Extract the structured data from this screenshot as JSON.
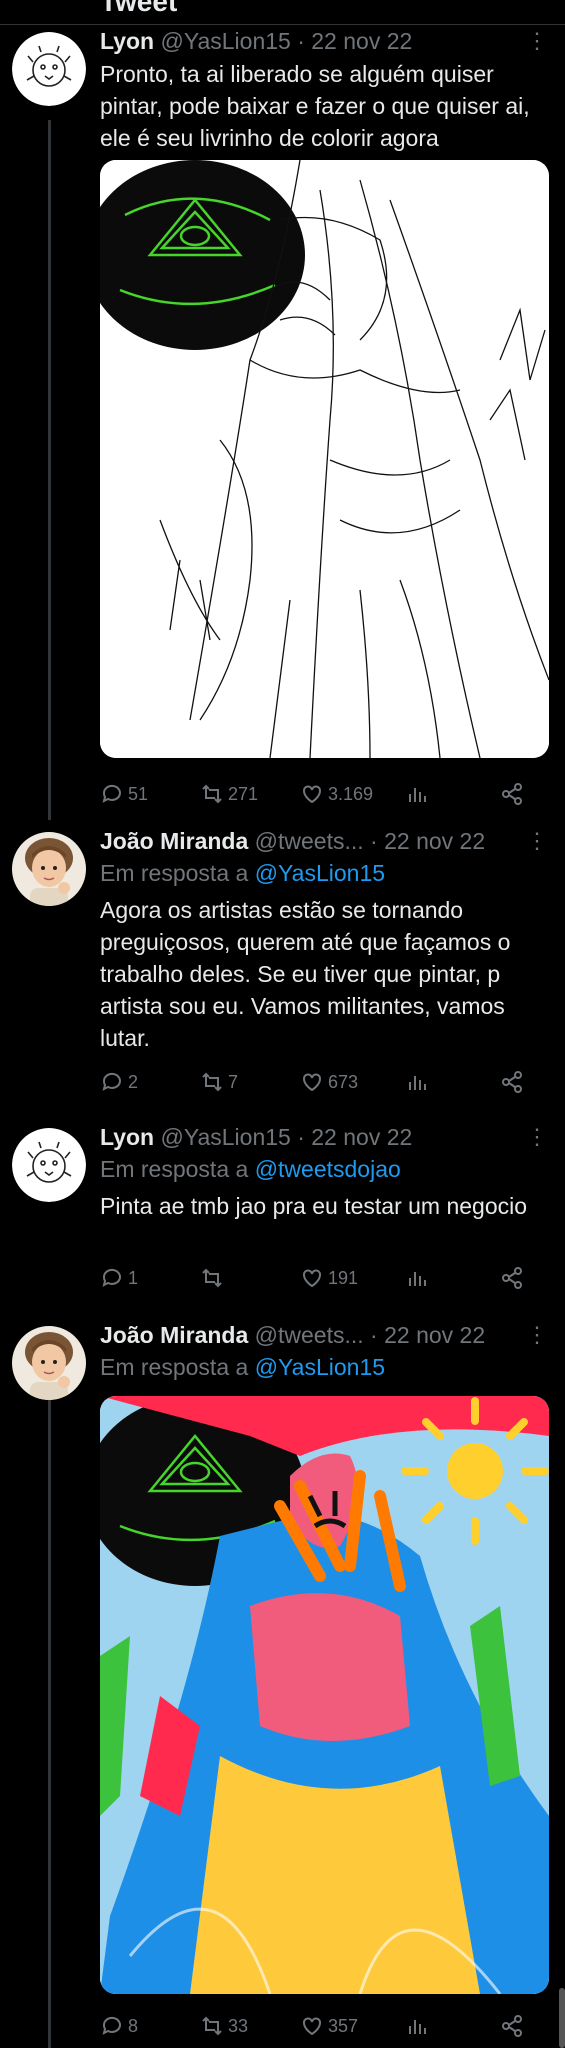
{
  "header": {
    "title": "Tweet"
  },
  "tweets": [
    {
      "name": "Lyon",
      "handle": "@YasLion15",
      "date": "· 22 nov 22",
      "reply_prefix": "",
      "reply_to": "",
      "text": "Pronto, ta ai liberado se alguém quiser pintar, pode baixar e fazer o que quiser ai, ele é seu livrinho de colorir agora",
      "replies": "51",
      "retweets": "271",
      "likes": "3.169"
    },
    {
      "name": "João Miranda",
      "handle": "@tweets...",
      "date": "· 22 nov 22",
      "reply_prefix": "Em resposta a ",
      "reply_to": "@YasLion15",
      "text": "Agora os artistas estão se tornando preguiçosos, querem até que façamos o trabalho deles. Se eu tiver que pintar, p artista sou eu. Vamos militantes, vamos lutar.",
      "replies": "2",
      "retweets": "7",
      "likes": "673"
    },
    {
      "name": "Lyon",
      "handle": "@YasLion15",
      "date": "· 22 nov 22",
      "reply_prefix": "Em resposta a ",
      "reply_to": "@tweetsdojao",
      "text": "Pinta ae tmb jao pra eu testar um negocio",
      "replies": "1",
      "retweets": "",
      "likes": "191"
    },
    {
      "name": "João Miranda",
      "handle": "@tweets...",
      "date": "· 22 nov 22",
      "reply_prefix": "Em resposta a ",
      "reply_to": "@YasLion15",
      "text": "",
      "replies": "8",
      "retweets": "33",
      "likes": "357"
    }
  ],
  "icons": {
    "more": "more-icon",
    "reply": "reply-icon",
    "retweet": "retweet-icon",
    "like": "heart-icon",
    "views": "views-icon",
    "share": "share-icon"
  },
  "colors": {
    "background": "#000000",
    "text": "#e7e9ea",
    "muted": "#71767b",
    "link": "#1d9bf0"
  }
}
